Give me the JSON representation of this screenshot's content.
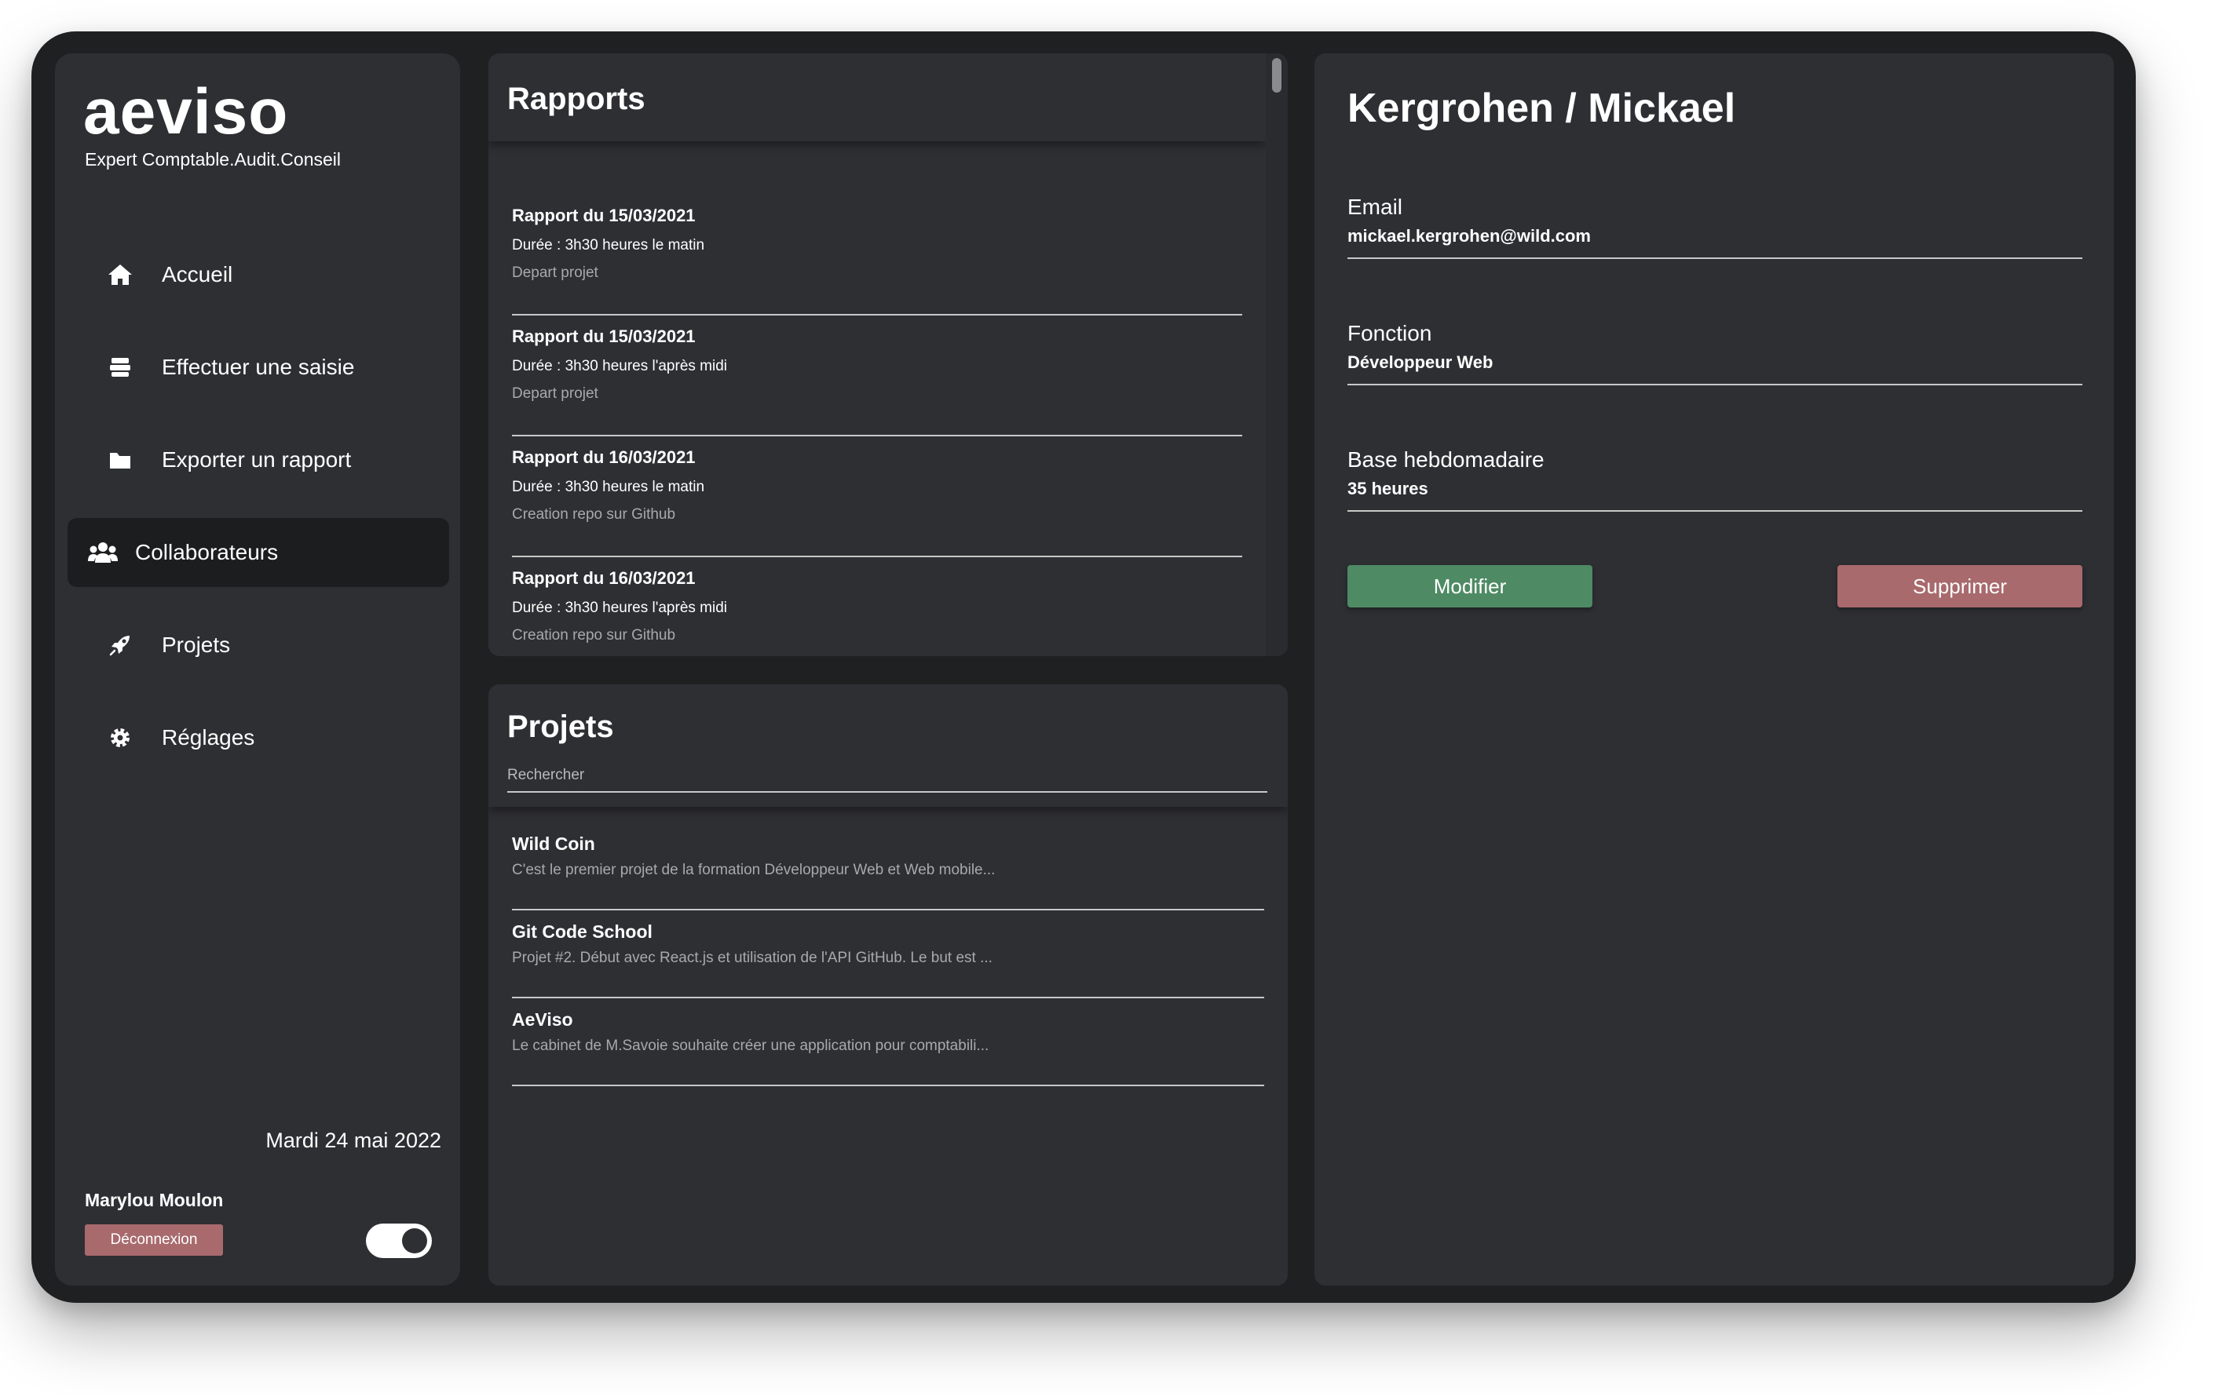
{
  "app": {
    "logo": "aeviso",
    "tagline": "Expert Comptable.Audit.Conseil"
  },
  "sidebar": {
    "items": [
      {
        "label": "Accueil",
        "icon": "home-icon"
      },
      {
        "label": "Effectuer une saisie",
        "icon": "stack-icon"
      },
      {
        "label": "Exporter un rapport",
        "icon": "folder-icon"
      },
      {
        "label": "Collaborateurs",
        "icon": "users-icon",
        "active": true
      },
      {
        "label": "Projets",
        "icon": "rocket-icon"
      },
      {
        "label": "Réglages",
        "icon": "gear-icon"
      }
    ],
    "date": "Mardi 24 mai 2022",
    "user_name": "Marylou Moulon",
    "logout_label": "Déconnexion",
    "theme_toggle_on": true
  },
  "reports": {
    "title": "Rapports",
    "items": [
      {
        "title": "Rapport du 15/03/2021",
        "duration": "Durée : 3h30 heures le matin",
        "description": "Depart projet"
      },
      {
        "title": "Rapport du 15/03/2021",
        "duration": "Durée : 3h30 heures l'après midi",
        "description": "Depart projet"
      },
      {
        "title": "Rapport du 16/03/2021",
        "duration": "Durée : 3h30 heures le matin",
        "description": "Creation repo sur Github"
      },
      {
        "title": "Rapport du 16/03/2021",
        "duration": "Durée : 3h30 heures l'après midi",
        "description": "Creation repo sur Github"
      }
    ]
  },
  "projects": {
    "title": "Projets",
    "search_placeholder": "Rechercher",
    "items": [
      {
        "title": "Wild Coin",
        "description": "C'est le premier projet de la formation Développeur Web et Web mobile..."
      },
      {
        "title": "Git Code School",
        "description": "Projet #2. Début avec React.js et utilisation de l'API GitHub. Le but est ..."
      },
      {
        "title": "AeViso",
        "description": "Le cabinet de M.Savoie souhaite créer une application pour comptabili..."
      }
    ]
  },
  "detail": {
    "name": "Kergrohen / Mickael",
    "fields": [
      {
        "label": "Email",
        "value": "mickael.kergrohen@wild.com"
      },
      {
        "label": "Fonction",
        "value": "Développeur Web"
      },
      {
        "label": "Base hebdomadaire",
        "value": "35 heures"
      }
    ],
    "modify_label": "Modifier",
    "delete_label": "Supprimer"
  },
  "colors": {
    "frame": "#1f2022",
    "panel": "#2e2f33",
    "modify": "#4e8a63",
    "delete": "#a86a6d"
  }
}
